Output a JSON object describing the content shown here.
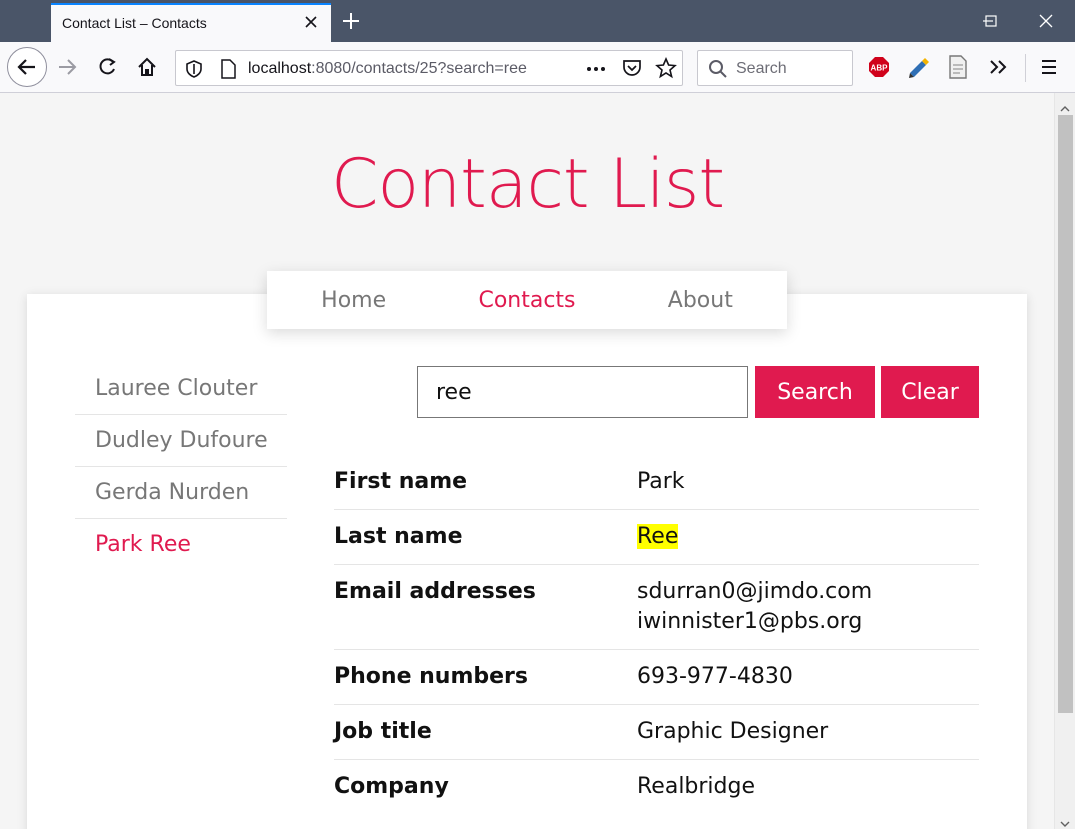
{
  "browser": {
    "tab_title": "Contact List – Contacts",
    "url_host": "localhost",
    "url_rest": ":8080/contacts/25?search=ree",
    "search_placeholder": "Search"
  },
  "page": {
    "title": "Contact List",
    "nav": [
      {
        "label": "Home",
        "active": false
      },
      {
        "label": "Contacts",
        "active": true
      },
      {
        "label": "About",
        "active": false
      }
    ],
    "sidebar": [
      {
        "label": "Lauree Clouter",
        "active": false
      },
      {
        "label": "Dudley Dufoure",
        "active": false
      },
      {
        "label": "Gerda Nurden",
        "active": false
      },
      {
        "label": "Park Ree",
        "active": true
      }
    ],
    "search": {
      "value": "ree",
      "search_label": "Search",
      "clear_label": "Clear"
    },
    "contact": {
      "first_name_label": "First name",
      "first_name": "Park",
      "last_name_label": "Last name",
      "last_name": "Ree",
      "emails_label": "Email addresses",
      "emails": [
        "sdurran0@jimdo.com",
        "iwinnister1@pbs.org"
      ],
      "phones_label": "Phone numbers",
      "phones": [
        "693-977-4830"
      ],
      "job_title_label": "Job title",
      "job_title": "Graphic Designer",
      "company_label": "Company",
      "company": "Realbridge"
    }
  },
  "colors": {
    "accent": "#e01a4f",
    "highlight": "#ffff00"
  }
}
